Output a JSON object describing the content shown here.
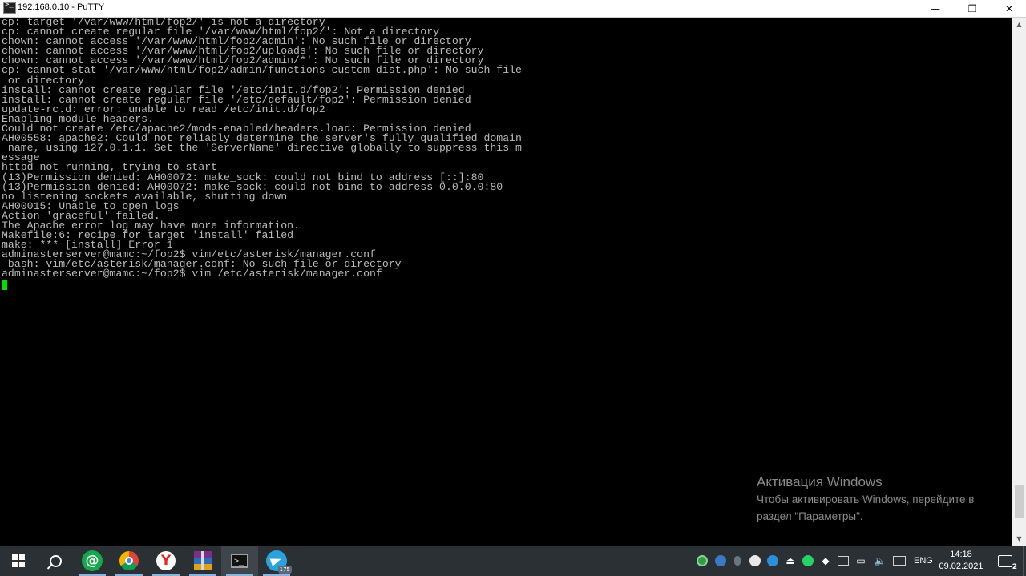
{
  "window": {
    "title": "192.168.0.10 - PuTTY",
    "minimize_glyph": "—",
    "maximize_glyph": "❐",
    "close_glyph": "✕"
  },
  "terminal": {
    "lines": [
      "cp: target '/var/www/html/fop2/' is not a directory",
      "cp: cannot create regular file '/var/www/html/fop2/': Not a directory",
      "chown: cannot access '/var/www/html/fop2/admin': No such file or directory",
      "chown: cannot access '/var/www/html/fop2/uploads': No such file or directory",
      "chown: cannot access '/var/www/html/fop2/admin/*': No such file or directory",
      "cp: cannot stat '/var/www/html/fop2/admin/functions-custom-dist.php': No such file",
      " or directory",
      "install: cannot create regular file '/etc/init.d/fop2': Permission denied",
      "install: cannot create regular file '/etc/default/fop2': Permission denied",
      "update-rc.d: error: unable to read /etc/init.d/fop2",
      "Enabling module headers.",
      "Could not create /etc/apache2/mods-enabled/headers.load: Permission denied",
      "AH00558: apache2: Could not reliably determine the server's fully qualified domain",
      " name, using 127.0.1.1. Set the 'ServerName' directive globally to suppress this m",
      "essage",
      "httpd not running, trying to start",
      "(13)Permission denied: AH00072: make_sock: could not bind to address [::]:80",
      "(13)Permission denied: AH00072: make_sock: could not bind to address 0.0.0.0:80",
      "no listening sockets available, shutting down",
      "AH00015: Unable to open logs",
      "Action 'graceful' failed.",
      "The Apache error log may have more information.",
      "Makefile:6: recipe for target 'install' failed",
      "make: *** [install] Error 1",
      "adminasterserver@mamc:~/fop2$ vim/etc/asterisk/manager.conf",
      "-bash: vim/etc/asterisk/manager.conf: No such file or directory",
      "adminasterserver@mamc:~/fop2$ vim /etc/asterisk/manager.conf"
    ],
    "cursor_color": "#00e000",
    "text_color": "#bbbbbb",
    "background": "#000000"
  },
  "activation": {
    "title": "Активация Windows",
    "line1": "Чтобы активировать Windows, перейдите в",
    "line2": "раздел \"Параметры\"."
  },
  "taskbar": {
    "apps": [
      {
        "name": "start-button",
        "icon": "windows-logo-icon"
      },
      {
        "name": "search-button",
        "icon": "search-icon"
      },
      {
        "name": "mail-ru-agent",
        "icon": "mail-at-icon",
        "glyph": "@"
      },
      {
        "name": "chrome",
        "icon": "chrome-icon"
      },
      {
        "name": "yandex-browser",
        "icon": "yandex-icon",
        "glyph": "Y"
      },
      {
        "name": "winrar",
        "icon": "winrar-icon"
      },
      {
        "name": "putty",
        "icon": "putty-icon",
        "glyph": ">_",
        "active": true
      },
      {
        "name": "telegram",
        "icon": "telegram-icon",
        "badge": "175"
      }
    ],
    "language": "ENG",
    "time": "14:18",
    "date": "09.02.2021",
    "notifications": "2"
  }
}
